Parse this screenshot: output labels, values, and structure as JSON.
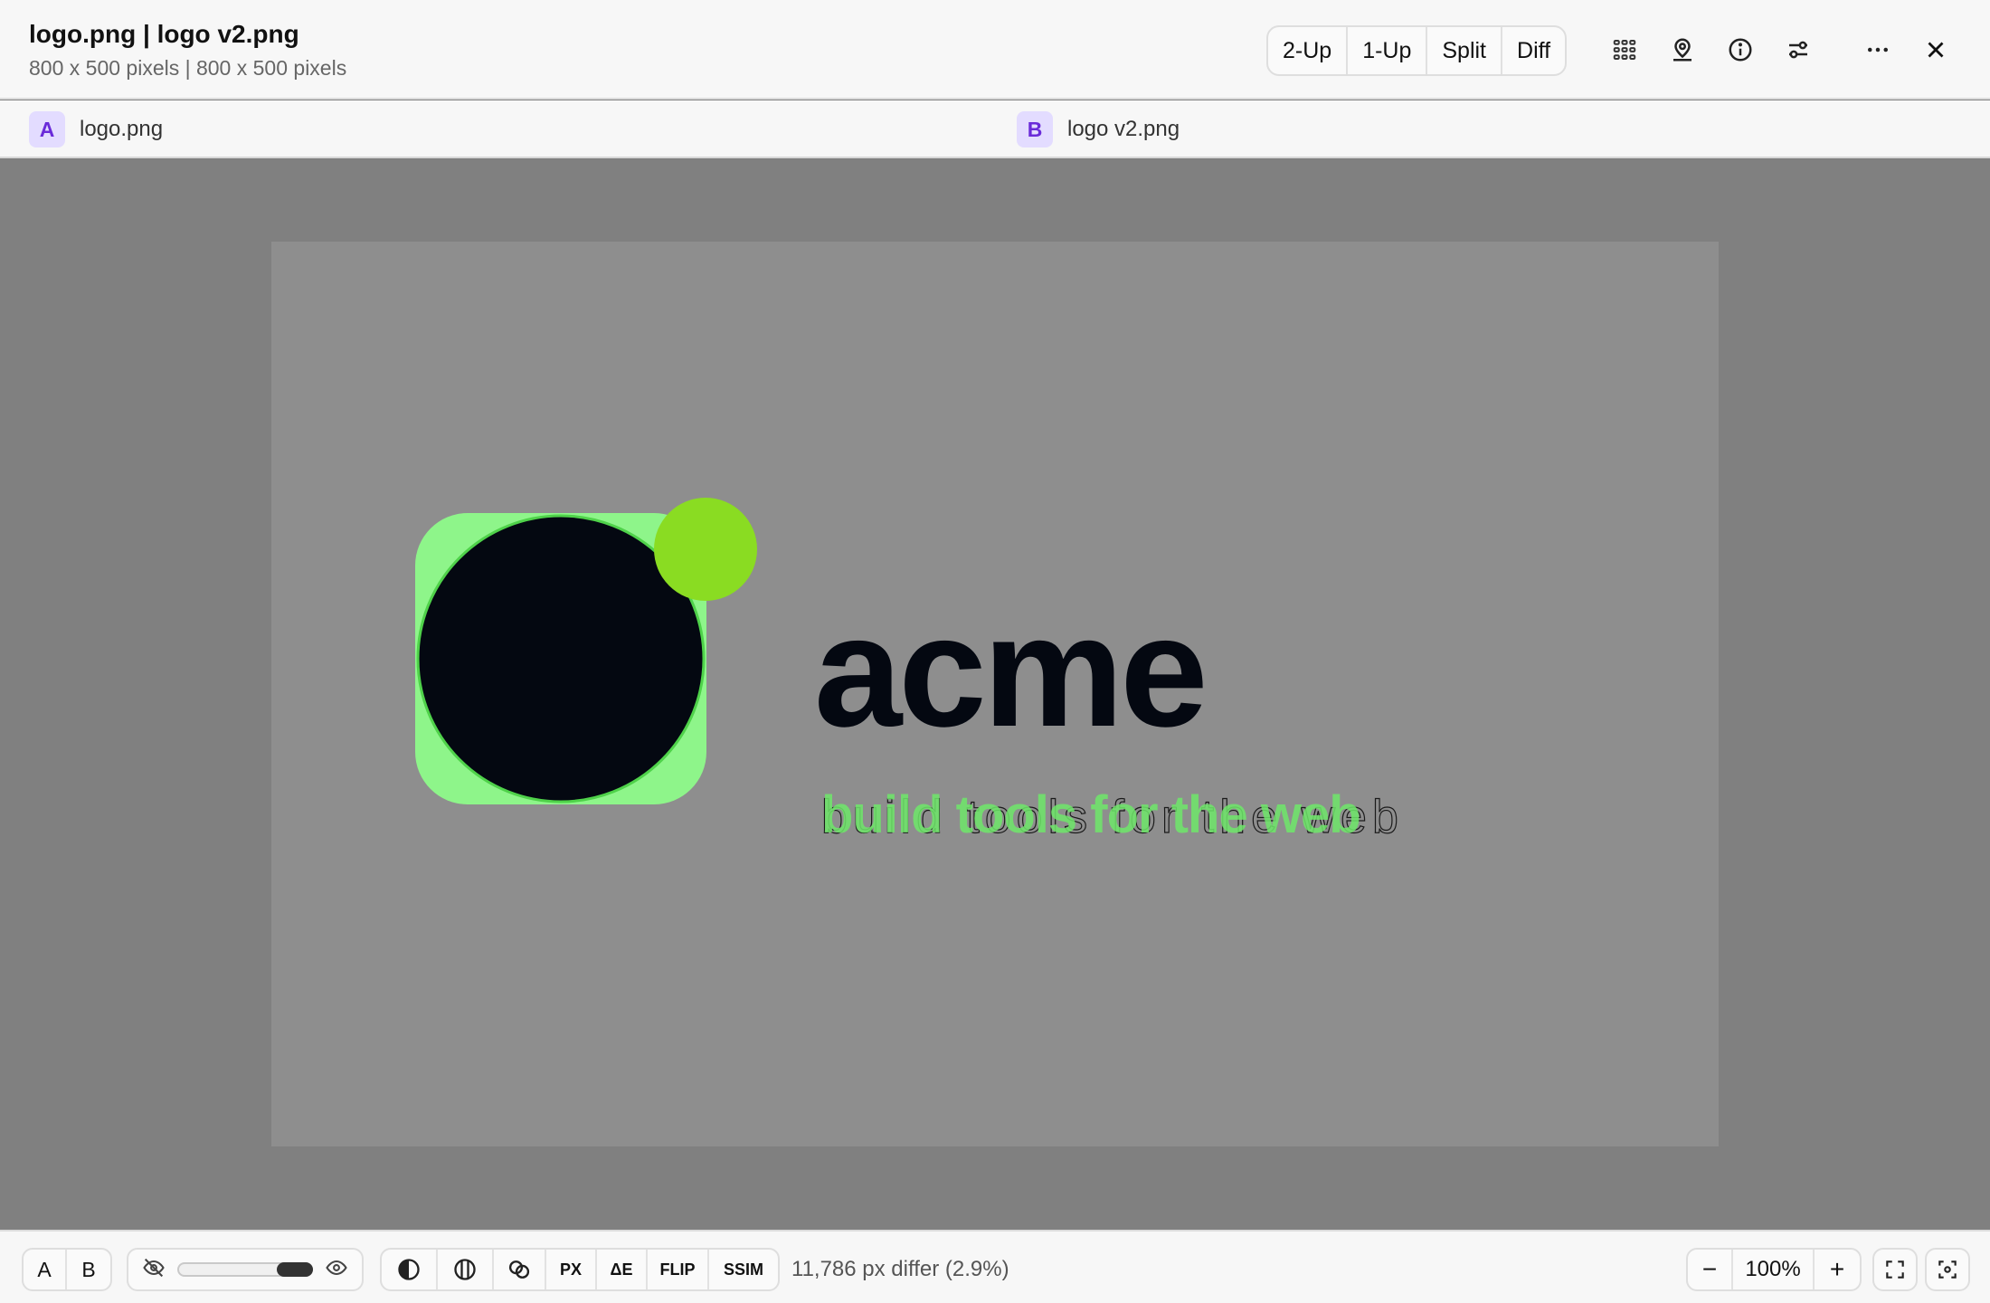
{
  "header": {
    "title": "logo.png | logo v2.png",
    "subtitle": "800 x 500 pixels | 800 x 500 pixels",
    "modes": [
      "2-Up",
      "1-Up",
      "Split",
      "Diff"
    ],
    "icons": [
      "grid-icon",
      "location-pin-icon",
      "info-icon",
      "sliders-icon",
      "more-icon",
      "close-icon"
    ]
  },
  "tabs": {
    "a": {
      "badge": "A",
      "label": "logo.png"
    },
    "b": {
      "badge": "B",
      "label": "logo v2.png"
    }
  },
  "canvas": {
    "wordmark": "acme",
    "tagline_a": "build tools for the web",
    "tagline_b": "build tools for the web",
    "diff_color": "#8ef58a",
    "accent_dot_color": "#8adc22",
    "mark_color": "#040811"
  },
  "footer": {
    "toggle_a": "A",
    "toggle_b": "B",
    "opacity_level": 1.0,
    "metric_px": "PX",
    "metric_de": "ΔE",
    "metric_flip": "FLIP",
    "metric_ssim": "SSIM",
    "diff_status": "11,786 px differ (2.9%)",
    "zoom_minus": "−",
    "zoom_value": "100%",
    "zoom_plus": "+"
  }
}
